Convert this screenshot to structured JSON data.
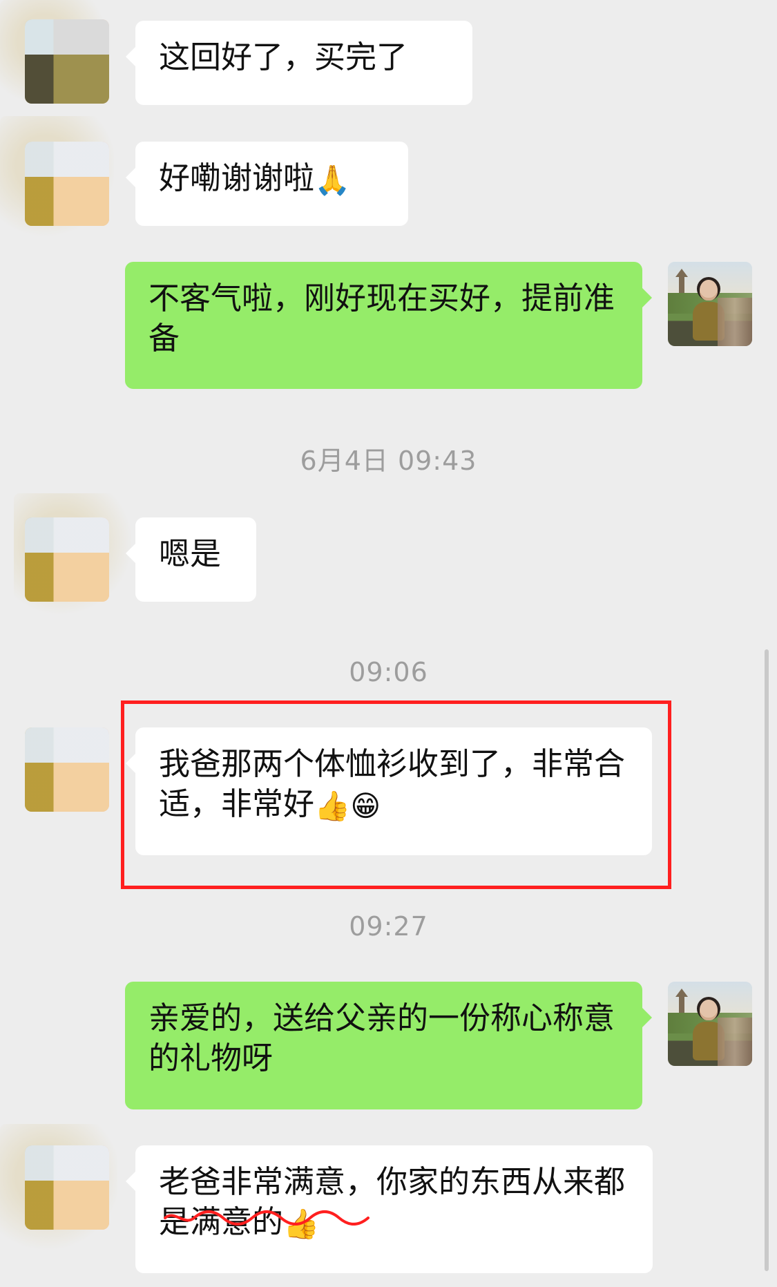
{
  "messages": [
    {
      "side": "left",
      "text": "这回好了，买完了"
    },
    {
      "side": "left",
      "text": "好嘞谢谢啦",
      "emoji": "🙏"
    },
    {
      "side": "right",
      "text": "不客气啦，刚好现在买好，提前准备"
    },
    {
      "timestamp": "6月4日 09:43"
    },
    {
      "side": "left",
      "text": "嗯是"
    },
    {
      "timestamp": "09:06"
    },
    {
      "side": "left",
      "text": "我爸那两个体恤衫收到了，非常合适，非常好",
      "emoji_1": "👍",
      "emoji_2": "😁"
    },
    {
      "timestamp": "09:27"
    },
    {
      "side": "right",
      "text": "亲爱的，送给父亲的一份称心称意的礼物呀"
    },
    {
      "side": "left",
      "text": "老爸非常满意，你家的东西从来都是满意的",
      "emoji": "👍"
    }
  ],
  "colors": {
    "background": "#ededed",
    "white_bubble": "#ffffff",
    "green_bubble": "#95ec69",
    "timestamp": "#9d9d9d",
    "highlight_box": "#ff1f1f",
    "underline": "#ff1f1f"
  },
  "icons": {
    "avatar_left": "blurred-avatar",
    "avatar_right": "profile-photo-avatar",
    "emoji_folded_hands": "folded-hands-icon",
    "emoji_thumbs_up": "thumbs-up-icon",
    "emoji_grin": "grinning-face-icon"
  }
}
